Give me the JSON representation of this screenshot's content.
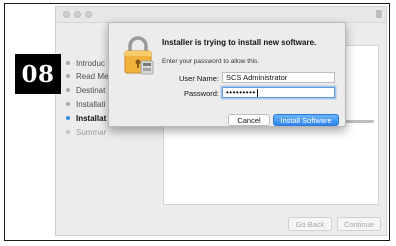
{
  "badge": {
    "text": "08"
  },
  "installer": {
    "steps": [
      {
        "label": "Introduc",
        "state": "done"
      },
      {
        "label": "Read Me",
        "state": "done"
      },
      {
        "label": "Destinat",
        "state": "done"
      },
      {
        "label": "Installati",
        "state": "done"
      },
      {
        "label": "Installat",
        "state": "current"
      },
      {
        "label": "Summar",
        "state": "future"
      }
    ],
    "buttons": {
      "back": "Go Back",
      "continue": "Continue"
    }
  },
  "auth_dialog": {
    "title": "Installer is trying to install new software.",
    "message": "Enter your password to allow this.",
    "username_label": "User Name:",
    "username_value": "SCS Administrator",
    "password_label": "Password:",
    "password_value": "•••••••••",
    "cancel_label": "Cancel",
    "install_label": "Install Software"
  },
  "colors": {
    "accent": "#2f86ee",
    "badge": "#000000"
  }
}
